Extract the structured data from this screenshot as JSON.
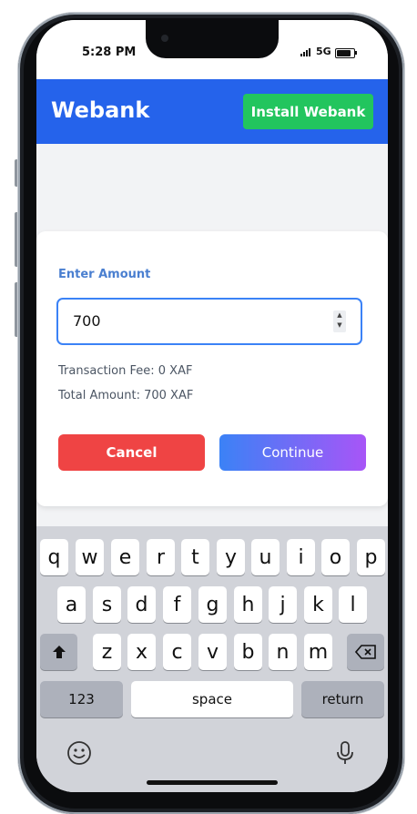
{
  "status_bar": {
    "time": "5:28 PM",
    "network": "5G"
  },
  "header": {
    "brand": "Webank",
    "install_label": "Install Webank"
  },
  "form": {
    "amount_label": "Enter Amount",
    "amount_value": "700",
    "fee_text": "Transaction Fee: 0 XAF",
    "total_text": "Total Amount: 700 XAF",
    "cancel_label": "Cancel",
    "continue_label": "Continue"
  },
  "keyboard": {
    "row1": [
      "q",
      "w",
      "e",
      "r",
      "t",
      "y",
      "u",
      "i",
      "o",
      "p"
    ],
    "row2": [
      "a",
      "s",
      "d",
      "f",
      "g",
      "h",
      "j",
      "k",
      "l"
    ],
    "row3": [
      "z",
      "x",
      "c",
      "v",
      "b",
      "n",
      "m"
    ],
    "numbers_label": "123",
    "space_label": "space",
    "return_label": "return"
  },
  "colors": {
    "header": "#2563eb",
    "install": "#22c55e",
    "cancel": "#ef4444",
    "continue_start": "#3b82f6",
    "continue_end": "#a855f7"
  }
}
